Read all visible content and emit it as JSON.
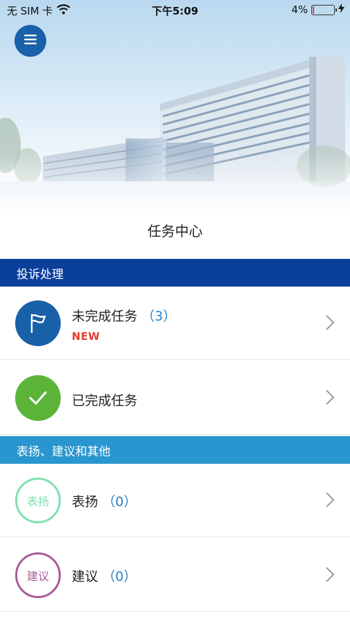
{
  "status_bar": {
    "carrier": "无 SIM 卡",
    "time": "下午5:09",
    "battery_percent_text": "4%",
    "battery_level": 0.04,
    "icons": [
      "wifi-icon",
      "battery-icon",
      "charging-bolt-icon"
    ]
  },
  "header": {
    "menu_icon": "menu-icon",
    "title": "任务中心"
  },
  "sections": [
    {
      "title": "投诉处理",
      "color": "#0b3f9c",
      "items": [
        {
          "label": "未完成任务",
          "count": "（3）",
          "badge": "NEW",
          "icon": "flag-icon",
          "icon_color": "#1961a8"
        },
        {
          "label": "已完成任务",
          "count": "",
          "badge": "",
          "icon": "checkmark-icon",
          "icon_color": "#5bb338"
        }
      ]
    },
    {
      "title": "表扬、建议和其他",
      "color": "#2a96cf",
      "items": [
        {
          "label": "表扬",
          "count": "（0）",
          "icon_text": "表扬",
          "icon_color": "#7ee0b0"
        },
        {
          "label": "建议",
          "count": "（0）",
          "icon_text": "建议",
          "icon_color": "#a85b96"
        }
      ]
    }
  ],
  "colors": {
    "accent_blue": "#1961a8",
    "count_blue": "#2b7fc0",
    "new_red": "#e63a2e"
  }
}
